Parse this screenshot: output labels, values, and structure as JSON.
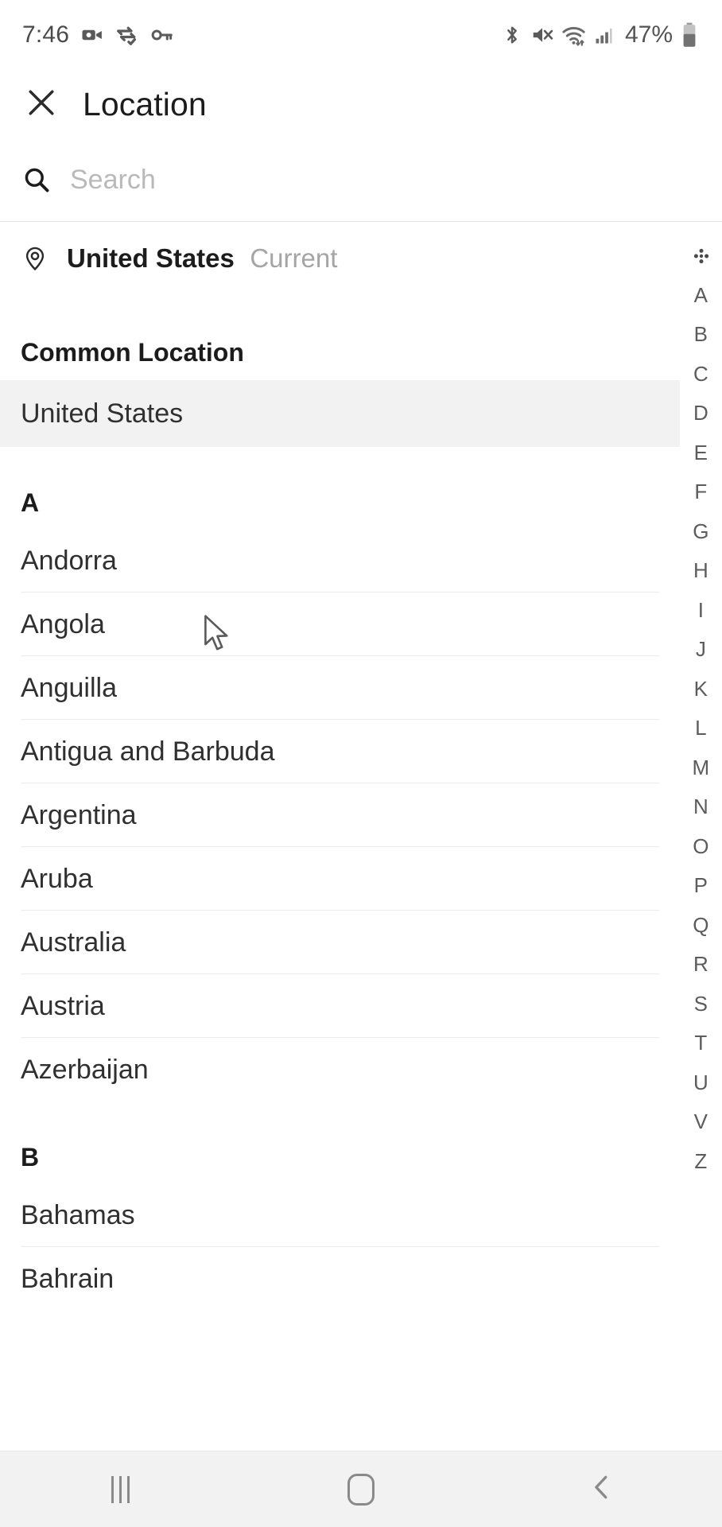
{
  "status_bar": {
    "time": "7:46",
    "battery_percent": "47%",
    "left_icons": [
      "video-camera-icon",
      "vpn-data-transfer-icon",
      "key-icon"
    ],
    "right_icons": [
      "bluetooth-icon",
      "volume-muted-icon",
      "wifi-icon",
      "cellular-signal-icon",
      "battery-icon"
    ]
  },
  "top_bar": {
    "close_icon": "close-icon",
    "title": "Location"
  },
  "search": {
    "icon": "search-icon",
    "placeholder": "Search",
    "value": ""
  },
  "current_location": {
    "icon": "location-pin-icon",
    "name": "United States",
    "tag": "Current"
  },
  "sections": [
    {
      "header": "Common Location",
      "items": [
        {
          "label": "United States",
          "highlighted": true,
          "divider": false
        }
      ]
    },
    {
      "header": "A",
      "items": [
        {
          "label": "Andorra",
          "highlighted": false,
          "divider": true
        },
        {
          "label": "Angola",
          "highlighted": false,
          "divider": true
        },
        {
          "label": "Anguilla",
          "highlighted": false,
          "divider": true
        },
        {
          "label": "Antigua and Barbuda",
          "highlighted": false,
          "divider": true
        },
        {
          "label": "Argentina",
          "highlighted": false,
          "divider": true
        },
        {
          "label": "Aruba",
          "highlighted": false,
          "divider": true
        },
        {
          "label": "Australia",
          "highlighted": false,
          "divider": true
        },
        {
          "label": "Austria",
          "highlighted": false,
          "divider": true
        },
        {
          "label": "Azerbaijan",
          "highlighted": false,
          "divider": false
        }
      ]
    },
    {
      "header": "B",
      "items": [
        {
          "label": "Bahamas",
          "highlighted": false,
          "divider": true
        },
        {
          "label": "Bahrain",
          "highlighted": false,
          "divider": false
        }
      ]
    }
  ],
  "index_rail": {
    "star_icon": "star-index-icon",
    "letters": [
      "A",
      "B",
      "C",
      "D",
      "E",
      "F",
      "G",
      "H",
      "I",
      "J",
      "K",
      "L",
      "M",
      "N",
      "O",
      "P",
      "Q",
      "R",
      "S",
      "T",
      "U",
      "V",
      "Z"
    ]
  },
  "nav_bar": {
    "recents_label": "recents-icon",
    "home_label": "home-icon",
    "back_label": "back-icon"
  },
  "colors": {
    "background": "#ffffff",
    "text_primary": "#1c1c1c",
    "text_secondary": "#a5a5a5",
    "highlight_row": "#f2f2f2",
    "divider": "#ececec",
    "navbar": "#f2f2f2"
  },
  "cursor": {
    "icon": "mouse-pointer-icon"
  }
}
